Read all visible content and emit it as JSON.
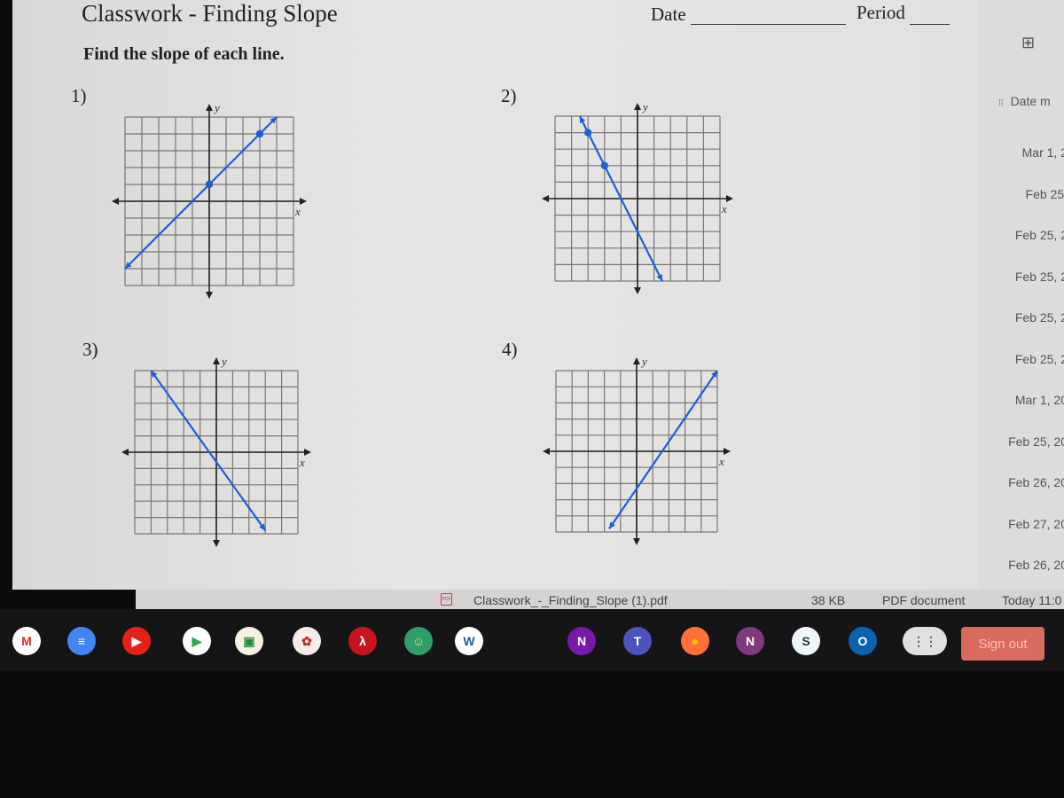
{
  "worksheet": {
    "title": "Classwork - Finding Slope",
    "date_label": "Date",
    "period_label": "Period",
    "instructions": "Find the slope of each line."
  },
  "chart_data": [
    {
      "type": "line",
      "number": "1)",
      "xlabel": "x",
      "ylabel": "y",
      "xlim": [
        -5,
        5
      ],
      "ylim": [
        -5,
        5
      ],
      "grid": true,
      "line": {
        "from": [
          -5,
          -4
        ],
        "to": [
          4,
          5
        ]
      },
      "points": [
        [
          0,
          1
        ],
        [
          3,
          4
        ]
      ],
      "color": "#1f5fd6"
    },
    {
      "type": "line",
      "number": "2)",
      "xlabel": "x",
      "ylabel": "y",
      "xlim": [
        -5,
        5
      ],
      "ylim": [
        -5,
        5
      ],
      "grid": true,
      "line": {
        "from": [
          -3.5,
          5
        ],
        "to": [
          1.5,
          -5
        ]
      },
      "points": [
        [
          -3,
          4
        ],
        [
          -2,
          2
        ]
      ],
      "color": "#1f5fd6"
    },
    {
      "type": "line",
      "number": "3)",
      "xlabel": "x",
      "ylabel": "y",
      "xlim": [
        -5,
        5
      ],
      "ylim": [
        -5,
        5
      ],
      "grid": true,
      "line": {
        "from": [
          -4,
          5
        ],
        "to": [
          3,
          -4.8
        ]
      },
      "points": [],
      "color": "#1f5fd6"
    },
    {
      "type": "line",
      "number": "4)",
      "xlabel": "x",
      "ylabel": "y",
      "xlim": [
        -5,
        5
      ],
      "ylim": [
        -5,
        5
      ],
      "grid": true,
      "line": {
        "from": [
          -1.7,
          -4.8
        ],
        "to": [
          5,
          5
        ]
      },
      "points": [],
      "color": "#1f5fd6"
    }
  ],
  "files_panel": {
    "column_header": "Date m",
    "dates": [
      "Mar 1, 2",
      "Feb 25,",
      "Feb 25, 2",
      "Feb 25, 2",
      "Feb 25, 2",
      "Feb 25, 2",
      "Mar 1, 20",
      "Feb 25, 20",
      "Feb 26, 20",
      "Feb 27, 20",
      "Feb 26, 20"
    ]
  },
  "download": {
    "filename": "Classwork_-_Finding_Slope (1).pdf",
    "size": "38 KB",
    "type": "PDF document",
    "modified": "Today 11:0"
  },
  "taskbar": {
    "apps": [
      {
        "name": "gmail",
        "glyph": "M",
        "color": "#ffffff",
        "fg": "#d93025"
      },
      {
        "name": "google-docs",
        "glyph": "≡",
        "color": "#4285f4",
        "fg": "#fff"
      },
      {
        "name": "youtube",
        "glyph": "▶",
        "color": "#e62117",
        "fg": "#fff"
      },
      {
        "name": "play-store",
        "glyph": "▶",
        "color": "#ffffff",
        "fg": "#34a853"
      },
      {
        "name": "google-classroom",
        "glyph": "▣",
        "color": "#f7f2e0",
        "fg": "#1e8e3e"
      },
      {
        "name": "rose-app",
        "glyph": "✿",
        "color": "#f3ece8",
        "fg": "#c62828"
      },
      {
        "name": "adobe-acrobat",
        "glyph": "λ",
        "color": "#c4161c",
        "fg": "#fff"
      },
      {
        "name": "character-app",
        "glyph": "☺",
        "color": "#2e9e6a",
        "fg": "#ffdd33"
      },
      {
        "name": "microsoft-word",
        "glyph": "W",
        "color": "#ffffff",
        "fg": "#2b579a"
      },
      {
        "name": "onenote",
        "glyph": "N",
        "color": "#7719aa",
        "fg": "#fff"
      },
      {
        "name": "microsoft-teams",
        "glyph": "T",
        "color": "#4b53bc",
        "fg": "#fff"
      },
      {
        "name": "firefox",
        "glyph": "●",
        "color": "#ff7139",
        "fg": "#ffcc00"
      },
      {
        "name": "onenote-alt",
        "glyph": "N",
        "color": "#80397b",
        "fg": "#fff"
      },
      {
        "name": "skype-s",
        "glyph": "S",
        "color": "#eef7f8",
        "fg": "#333"
      },
      {
        "name": "outlook",
        "glyph": "O",
        "color": "#0a64ad",
        "fg": "#fff"
      },
      {
        "name": "app-launcher",
        "glyph": "⋮⋮",
        "color": "#e0e0e0",
        "fg": "#555"
      }
    ],
    "sign_out": "Sign out"
  }
}
